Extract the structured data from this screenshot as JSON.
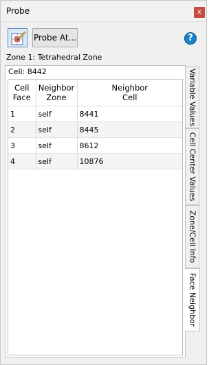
{
  "window": {
    "title": "Probe",
    "close_label": "x"
  },
  "toolbar": {
    "probe_at_label": "Probe At...",
    "help_label": "?"
  },
  "zone_label": "Zone 1: Tetrahedral Zone",
  "cell_label": "Cell: 8442",
  "table": {
    "headers": [
      [
        "Cell",
        "Face"
      ],
      [
        "Neighbor",
        "Zone"
      ],
      [
        "Neighbor",
        "Cell"
      ]
    ],
    "rows": [
      [
        "1",
        "self",
        "8441"
      ],
      [
        "2",
        "self",
        "8445"
      ],
      [
        "3",
        "self",
        "8612"
      ],
      [
        "4",
        "self",
        "10876"
      ]
    ]
  },
  "tabs": [
    {
      "label": "Variable Values",
      "active": false
    },
    {
      "label": "Cell Center Values",
      "active": false
    },
    {
      "label": "Zone/Cell Info",
      "active": false
    },
    {
      "label": "Face Neighbor",
      "active": true
    }
  ],
  "colors": {
    "close_button": "#c94d3e",
    "help_icon": "#1e82c8",
    "probe_button_border": "#5d8bc5"
  },
  "icons": {
    "close": "close-icon",
    "probe": "probe-crosshair-icon",
    "help": "help-icon"
  }
}
